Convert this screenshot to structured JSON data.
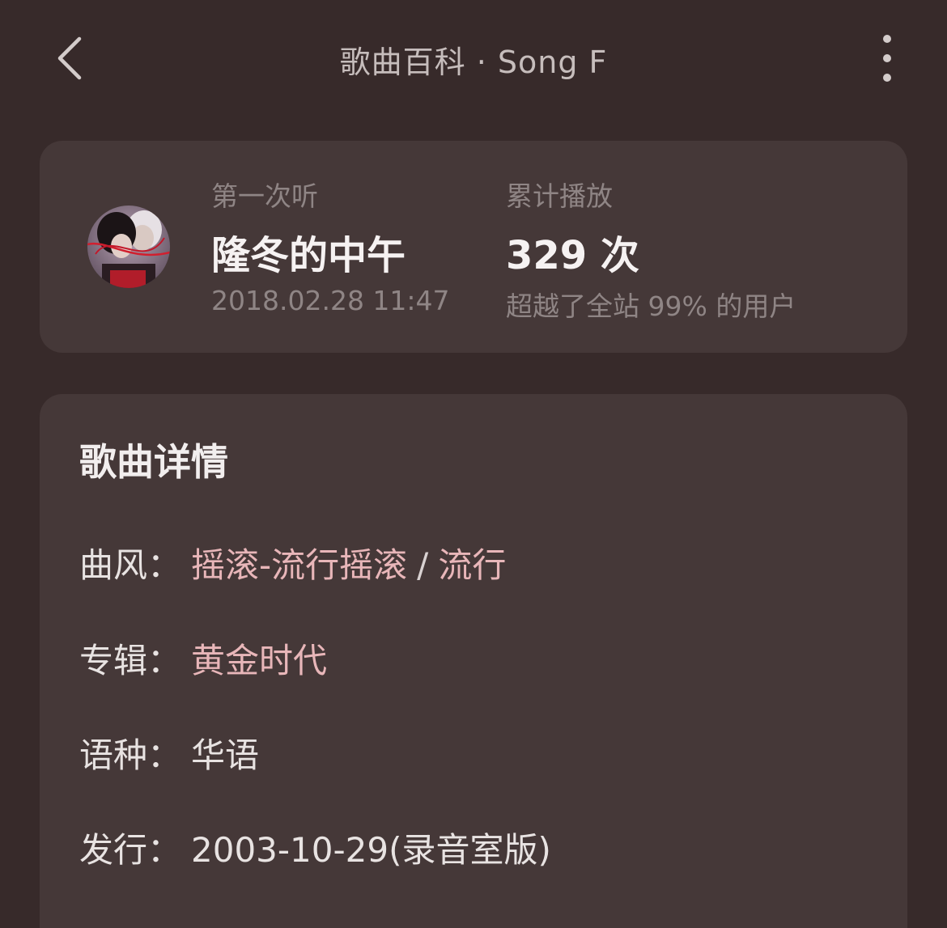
{
  "header": {
    "title": "歌曲百科 · Song F"
  },
  "stats": {
    "first_listen_label": "第一次听",
    "first_listen_value": "隆冬的中午",
    "first_listen_time": "2018.02.28 11:47",
    "plays_label": "累计播放",
    "plays_value": "329 次",
    "plays_rank": "超越了全站 99% 的用户"
  },
  "details": {
    "title": "歌曲详情",
    "genre_key": "曲风：",
    "genre_values": [
      "摇滚-流行摇滚",
      "流行"
    ],
    "genre_sep": "/",
    "album_key": "专辑：",
    "album_value": "黄金时代",
    "language_key": "语种：",
    "language_value": "华语",
    "release_key": "发行：",
    "release_value": "2003-10-29(录音室版)"
  },
  "colors": {
    "background": "#372a2a",
    "card": "#453838",
    "link": "#e8b6b9"
  }
}
